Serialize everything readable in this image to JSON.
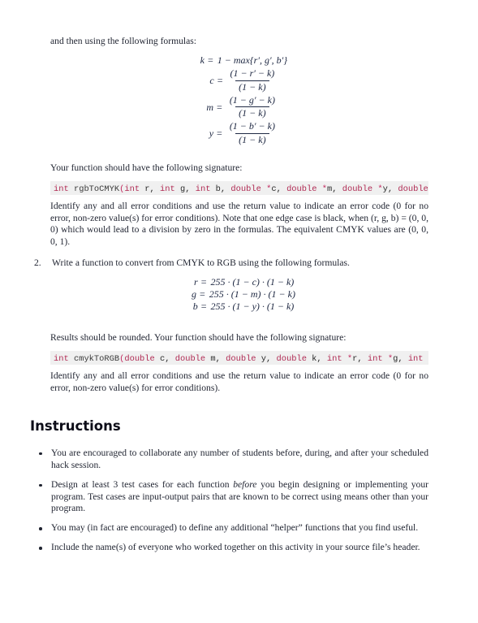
{
  "document": {
    "intro_line": "and then using the following formulas:",
    "formulas_rgb_to_cmyk": {
      "type": "display-math",
      "equations": [
        {
          "lhs": "k",
          "rhs_kind": "plain",
          "rhs": "1 − max{r′, g′, b′}"
        },
        {
          "lhs": "c",
          "rhs_kind": "fraction",
          "numerator": "(1 − r′ − k)",
          "denominator": "(1 − k)"
        },
        {
          "lhs": "m",
          "rhs_kind": "fraction",
          "numerator": "(1 − g′ − k)",
          "denominator": "(1 − k)"
        },
        {
          "lhs": "y",
          "rhs_kind": "fraction",
          "numerator": "(1 − b′ − k)",
          "denominator": "(1 − k)"
        }
      ]
    },
    "signature_intro_1": "Your function should have the following signature:",
    "code_signature_1": {
      "language": "c",
      "text": "int rgbToCMYK(int r, int g, int b, double *c, double *m, double *y, double *k)",
      "tokens": [
        {
          "t": "int",
          "c": "kw"
        },
        {
          "t": " ",
          "c": "id"
        },
        {
          "t": "rgbToCMYK",
          "c": "fn"
        },
        {
          "t": "(",
          "c": "pn"
        },
        {
          "t": "int",
          "c": "kw"
        },
        {
          "t": " r",
          "c": "id"
        },
        {
          "t": ", ",
          "c": "cm"
        },
        {
          "t": "int",
          "c": "kw"
        },
        {
          "t": " g",
          "c": "id"
        },
        {
          "t": ", ",
          "c": "cm"
        },
        {
          "t": "int",
          "c": "kw"
        },
        {
          "t": " b",
          "c": "id"
        },
        {
          "t": ", ",
          "c": "cm"
        },
        {
          "t": "double",
          "c": "kw"
        },
        {
          "t": " ",
          "c": "id"
        },
        {
          "t": "*",
          "c": "op"
        },
        {
          "t": "c",
          "c": "id"
        },
        {
          "t": ", ",
          "c": "cm"
        },
        {
          "t": "double",
          "c": "kw"
        },
        {
          "t": " ",
          "c": "id"
        },
        {
          "t": "*",
          "c": "op"
        },
        {
          "t": "m",
          "c": "id"
        },
        {
          "t": ", ",
          "c": "cm"
        },
        {
          "t": "double",
          "c": "kw"
        },
        {
          "t": " ",
          "c": "id"
        },
        {
          "t": "*",
          "c": "op"
        },
        {
          "t": "y",
          "c": "id"
        },
        {
          "t": ", ",
          "c": "cm"
        },
        {
          "t": "double",
          "c": "kw"
        },
        {
          "t": " ",
          "c": "id"
        },
        {
          "t": "*",
          "c": "op"
        },
        {
          "t": "k",
          "c": "id"
        },
        {
          "t": ")",
          "c": "pn"
        }
      ]
    },
    "error_paragraph_1": "Identify any and all error conditions and use the return value to indicate an error code (0 for no error, non-zero value(s) for error conditions).  Note that one edge case is black, when (r, g, b) = (0, 0, 0) which would lead to a division by zero in the formulas. The equivalent CMYK values are (0, 0, 0, 1).",
    "item2": {
      "marker": "2.",
      "text": "Write a function to convert from CMYK to RGB using the following formulas."
    },
    "formulas_cmyk_to_rgb": {
      "type": "display-math",
      "equations": [
        {
          "lhs": "r",
          "rhs": "255 · (1 − c) · (1 − k)"
        },
        {
          "lhs": "g",
          "rhs": "255 · (1 − m) · (1 − k)"
        },
        {
          "lhs": "b",
          "rhs": "255 · (1 − y) · (1 − k)"
        }
      ]
    },
    "signature_intro_2": "Results should be rounded. Your function should have the following signature:",
    "code_signature_2": {
      "language": "c",
      "text": "int cmykToRGB(double c, double m, double y, double k, int *r, int *g, int *b)",
      "tokens": [
        {
          "t": "int",
          "c": "kw"
        },
        {
          "t": " ",
          "c": "id"
        },
        {
          "t": "cmykToRGB",
          "c": "fn"
        },
        {
          "t": "(",
          "c": "pn"
        },
        {
          "t": "double",
          "c": "kw"
        },
        {
          "t": " c",
          "c": "id"
        },
        {
          "t": ", ",
          "c": "cm"
        },
        {
          "t": "double",
          "c": "kw"
        },
        {
          "t": " m",
          "c": "id"
        },
        {
          "t": ", ",
          "c": "cm"
        },
        {
          "t": "double",
          "c": "kw"
        },
        {
          "t": " y",
          "c": "id"
        },
        {
          "t": ", ",
          "c": "cm"
        },
        {
          "t": "double",
          "c": "kw"
        },
        {
          "t": " k",
          "c": "id"
        },
        {
          "t": ", ",
          "c": "cm"
        },
        {
          "t": "int",
          "c": "kw"
        },
        {
          "t": " ",
          "c": "id"
        },
        {
          "t": "*",
          "c": "op"
        },
        {
          "t": "r",
          "c": "id"
        },
        {
          "t": ", ",
          "c": "cm"
        },
        {
          "t": "int",
          "c": "kw"
        },
        {
          "t": " ",
          "c": "id"
        },
        {
          "t": "*",
          "c": "op"
        },
        {
          "t": "g",
          "c": "id"
        },
        {
          "t": ", ",
          "c": "cm"
        },
        {
          "t": "int",
          "c": "kw"
        },
        {
          "t": " ",
          "c": "id"
        },
        {
          "t": "*",
          "c": "op"
        },
        {
          "t": "b",
          "c": "id"
        },
        {
          "t": ")",
          "c": "pn"
        }
      ]
    },
    "error_paragraph_2": "Identify any and all error conditions and use the return value to indicate an error code (0 for no error, non-zero value(s) for error conditions).",
    "instructions_heading": "Instructions",
    "instructions": [
      {
        "segments": [
          {
            "text": "You are encouraged to collaborate any number of students before, during, and after your scheduled hack session.",
            "style": "normal"
          }
        ]
      },
      {
        "segments": [
          {
            "text": "Design at least 3 test cases for each function ",
            "style": "normal"
          },
          {
            "text": "before",
            "style": "italic"
          },
          {
            "text": " you begin designing or implementing your program.  Test cases are input-output pairs that are known to be correct using means other than your program.",
            "style": "normal"
          }
        ]
      },
      {
        "segments": [
          {
            "text": "You may (in fact are encouraged) to define any additional “helper” functions that you find useful.",
            "style": "normal"
          }
        ]
      },
      {
        "segments": [
          {
            "text": "Include the name(s) of everyone who worked together on this activity in your source file’s header.",
            "style": "normal"
          }
        ]
      }
    ]
  },
  "colors": {
    "body_text": "#1f2330",
    "math_text": "#202a44",
    "code_background": "#f0f0f0",
    "code_keyword": "#b02a53",
    "code_function": "#3b3b3b",
    "code_punctuation": "#c2255c",
    "heading": "#0d0d18",
    "page_background": "#ffffff"
  }
}
